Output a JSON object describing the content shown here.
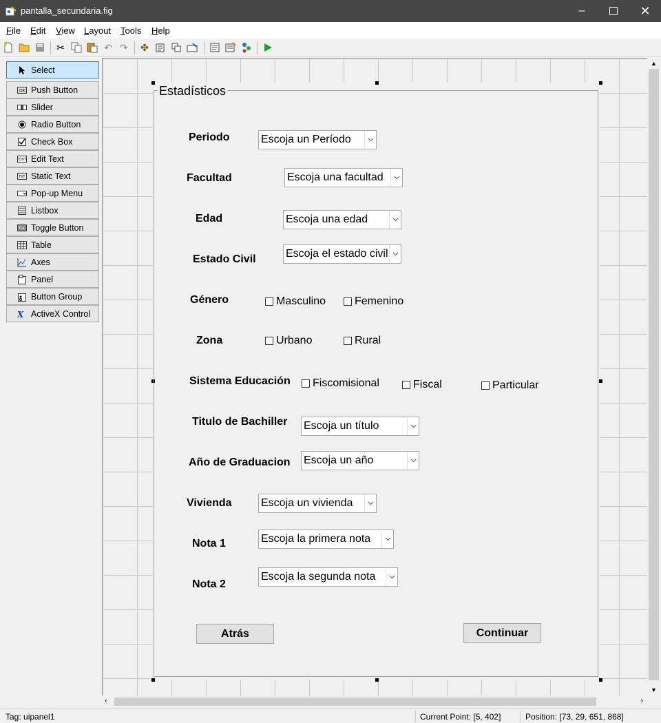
{
  "window": {
    "title": "pantalla_secundaria.fig"
  },
  "menu": [
    {
      "label": "File",
      "key": "F",
      "rest": "ile"
    },
    {
      "label": "Edit",
      "key": "E",
      "rest": "dit"
    },
    {
      "label": "View",
      "key": "V",
      "rest": "iew"
    },
    {
      "label": "Layout",
      "key": "L",
      "rest": "ayout"
    },
    {
      "label": "Tools",
      "key": "T",
      "rest": "ools"
    },
    {
      "label": "Help",
      "key": "H",
      "rest": "elp"
    }
  ],
  "palette": [
    {
      "label": "Select",
      "icon": "pointer-icon"
    },
    {
      "label": "Push Button",
      "icon": "push-button-icon"
    },
    {
      "label": "Slider",
      "icon": "slider-icon"
    },
    {
      "label": "Radio Button",
      "icon": "radio-button-icon"
    },
    {
      "label": "Check Box",
      "icon": "check-box-icon"
    },
    {
      "label": "Edit Text",
      "icon": "edit-text-icon"
    },
    {
      "label": "Static Text",
      "icon": "static-text-icon"
    },
    {
      "label": "Pop-up Menu",
      "icon": "popup-menu-icon"
    },
    {
      "label": "Listbox",
      "icon": "listbox-icon"
    },
    {
      "label": "Toggle Button",
      "icon": "toggle-button-icon"
    },
    {
      "label": "Table",
      "icon": "table-icon"
    },
    {
      "label": "Axes",
      "icon": "axes-icon"
    },
    {
      "label": "Panel",
      "icon": "panel-icon"
    },
    {
      "label": "Button Group",
      "icon": "button-group-icon"
    },
    {
      "label": "ActiveX Control",
      "icon": "activex-icon"
    }
  ],
  "panel": {
    "title": "Estadísticos"
  },
  "form": {
    "periodo": {
      "label": "Periodo",
      "value": "Escoja un Período"
    },
    "facultad": {
      "label": "Facultad",
      "value": "Escoja una facultad"
    },
    "edad": {
      "label": "Edad",
      "value": "Escoja una edad"
    },
    "estado_civil": {
      "label": "Estado Civil",
      "value": "Escoja el estado civil"
    },
    "genero": {
      "label": "Género",
      "options": [
        "Masculino",
        "Femenino"
      ]
    },
    "zona": {
      "label": "Zona",
      "options": [
        "Urbano",
        "Rural"
      ]
    },
    "sistema": {
      "label": "Sistema Educación",
      "options": [
        "Fiscomisional",
        "Fiscal",
        "Particular"
      ]
    },
    "titulo": {
      "label": "Titulo de Bachiller",
      "value": "Escoja un título"
    },
    "anio": {
      "label": "Año de Graduacion",
      "value": "Escoja un año"
    },
    "vivienda": {
      "label": "Vivienda",
      "value": "Escoja un vivienda"
    },
    "nota1": {
      "label": "Nota 1",
      "value": "Escoja la primera nota"
    },
    "nota2": {
      "label": "Nota 2",
      "value": "Escoja la segunda nota"
    }
  },
  "buttons": {
    "atras": "Atrás",
    "continuar": "Continuar"
  },
  "status": {
    "tag": "Tag: uipanel1",
    "current_point": "Current Point:  [5, 402]",
    "position": "Position: [73, 29, 651, 868]"
  }
}
